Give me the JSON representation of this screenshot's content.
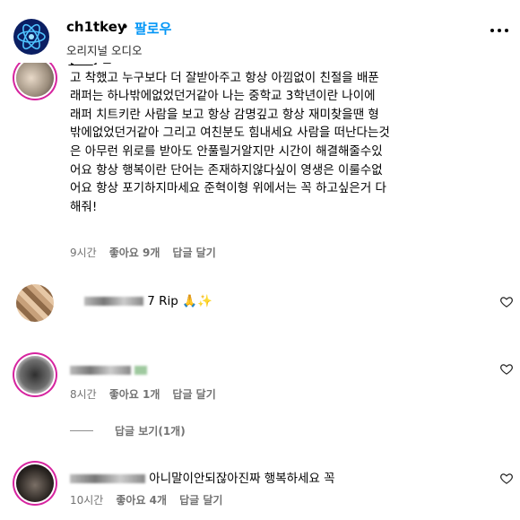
{
  "header": {
    "username": "ch1tkey",
    "separator": "•",
    "follow_label": "팔로우",
    "audio_label": "오리지널 오디오"
  },
  "comments": [
    {
      "text": "[̲̅_̲̅_̲̅_̲̅] 는 ...\n고 착했고 누구보다 더 잘받아주고 항상 아낌없이 친절을 배푼\n래퍼는 하나밖에없었던거같아 나는 중학교 3학년이란 나이에\n래퍼 치트키란 사람을 보고 항상 감명깊고 항상 재미찾을땐 형\n밖에없었던거같아 그리고 여친분도 힘내세요 사람을 떠난다는것\n은 아무런 위로를 받아도 안풀릴거알지만 시간이 해결해줄수있\n어요 항상 행복이란 단어는 존재하지않다싶이 영생은 이룰수없\n어요 항상 포기하지마세요 준혁이형 위에서는 꼭 하고싶은거 다\n해줘!",
      "time": "9시간",
      "likes": "좋아요 9개",
      "reply": "답글 달기"
    },
    {
      "text_suffix": "7 Rip",
      "emoji": "🙏✨",
      "time": "",
      "likes": "",
      "reply": ""
    },
    {
      "text_suffix": "",
      "time": "8시간",
      "likes": "좋아요 1개",
      "reply": "답글 달기",
      "view_replies": "답글 보기(1개)"
    },
    {
      "text_suffix": "아니말이안되잖아진짜 행복하세요 꼭",
      "time": "10시간",
      "likes": "좋아요 4개",
      "reply": "답글 달기"
    }
  ],
  "colors": {
    "follow": "#0095f6",
    "muted": "#737373",
    "ring": "#d6249f"
  }
}
